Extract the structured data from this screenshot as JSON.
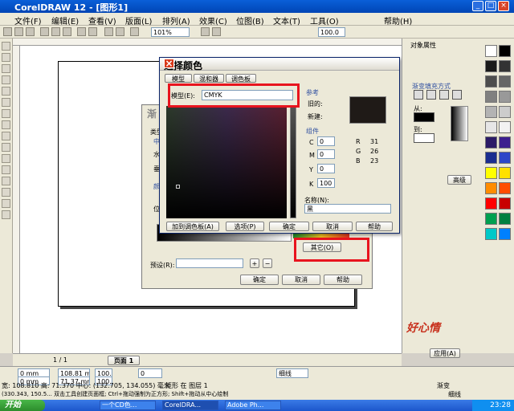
{
  "app": {
    "title": "CorelDRAW 12 - [图形1]",
    "minimize": "_",
    "maximize": "□",
    "close": "×"
  },
  "menu": [
    "文件(F)",
    "编辑(E)",
    "查看(V)",
    "版面(L)",
    "排列(A)",
    "效果(C)",
    "位图(B)",
    "文本(T)",
    "工具(O)",
    "帮助(H)"
  ],
  "toolbar": {
    "zoom": "101%",
    "outline": "100.0"
  },
  "dialog": {
    "title": "选择颜色",
    "close": "×",
    "tabs": [
      "模型",
      "混和器",
      "调色板"
    ],
    "model_label": "模型(E):",
    "model_value": "CMYK",
    "reference_label": "参考",
    "old_label": "旧的:",
    "new_label": "新建:",
    "components_label": "组件",
    "c_label": "C",
    "c_value": "0",
    "m_label": "M",
    "m_value": "0",
    "y_label": "Y",
    "y_value": "0",
    "k_label": "K",
    "k_value": "100",
    "r_label": "R",
    "r_value": "31",
    "g_label": "G",
    "g_value": "26",
    "b_label": "B",
    "b_value": "23",
    "name_label": "名称(N):",
    "name_value": "黑",
    "add_palette": "加到调色板(A)",
    "options": "选项(P)",
    "ok": "确定",
    "cancel": "取消",
    "help": "帮助"
  },
  "bg_dialog": {
    "title": "渐",
    "type_label": "类型",
    "center_label": "中心",
    "h_label": "水",
    "v_label": "垂",
    "color_label": "颜色",
    "pos_label": "位",
    "other_button": "其它(O)",
    "preset_label": "预设(R):",
    "ok": "确定",
    "cancel": "取消",
    "help": "帮助"
  },
  "docker": {
    "title": "对象属性",
    "fill_mode": "渐变填充方式",
    "from_label": "从:",
    "to_label": "到:",
    "advanced": "高级",
    "apply": "应用(A)"
  },
  "pagebar": {
    "count": "1 / 1",
    "page_tab": "页面 1"
  },
  "propbar": {
    "x": "0 mm",
    "y": "0 mm",
    "w": "108.81 mm",
    "h": "71.37 mm",
    "sx": "100.0",
    "sy": "100.0",
    "angle": "0",
    "outline_width": "细线"
  },
  "status": {
    "line1": "宽: 108.810  高: 71.370  中心: (132.705, 134.055)  毫米",
    "line1b": "矩形 在 图层 1",
    "line2": "(330.343, 150.5...  双击工具创建页面框; Ctrl+拖动强制为正方形; Shift+拖动从中心绘制",
    "fill_label": "渐变",
    "outline_label": "细线"
  },
  "taskbar": {
    "start": "开始",
    "tasks": [
      "一个CD色...",
      "CorelDRA...",
      "Adobe Ph..."
    ],
    "clock": "23:28"
  },
  "logo": "好心情",
  "colors": {
    "accent": "#0a5fd8",
    "highlight": "#e8141e"
  },
  "palette": [
    "#ffffff",
    "#000000",
    "#1a1a1a",
    "#333333",
    "#4d4d4d",
    "#666666",
    "#808080",
    "#999999",
    "#b3b3b3",
    "#cccccc",
    "#e6e6e6",
    "#f2f2f2",
    "#2b1a66",
    "#3d1f8f",
    "#1a2d8f",
    "#2d47c8",
    "#ffff00",
    "#ffe000",
    "#ff8c00",
    "#ff4d00",
    "#ff0000",
    "#c80000",
    "#00a050",
    "#008040",
    "#00c8c8",
    "#0080ff"
  ]
}
